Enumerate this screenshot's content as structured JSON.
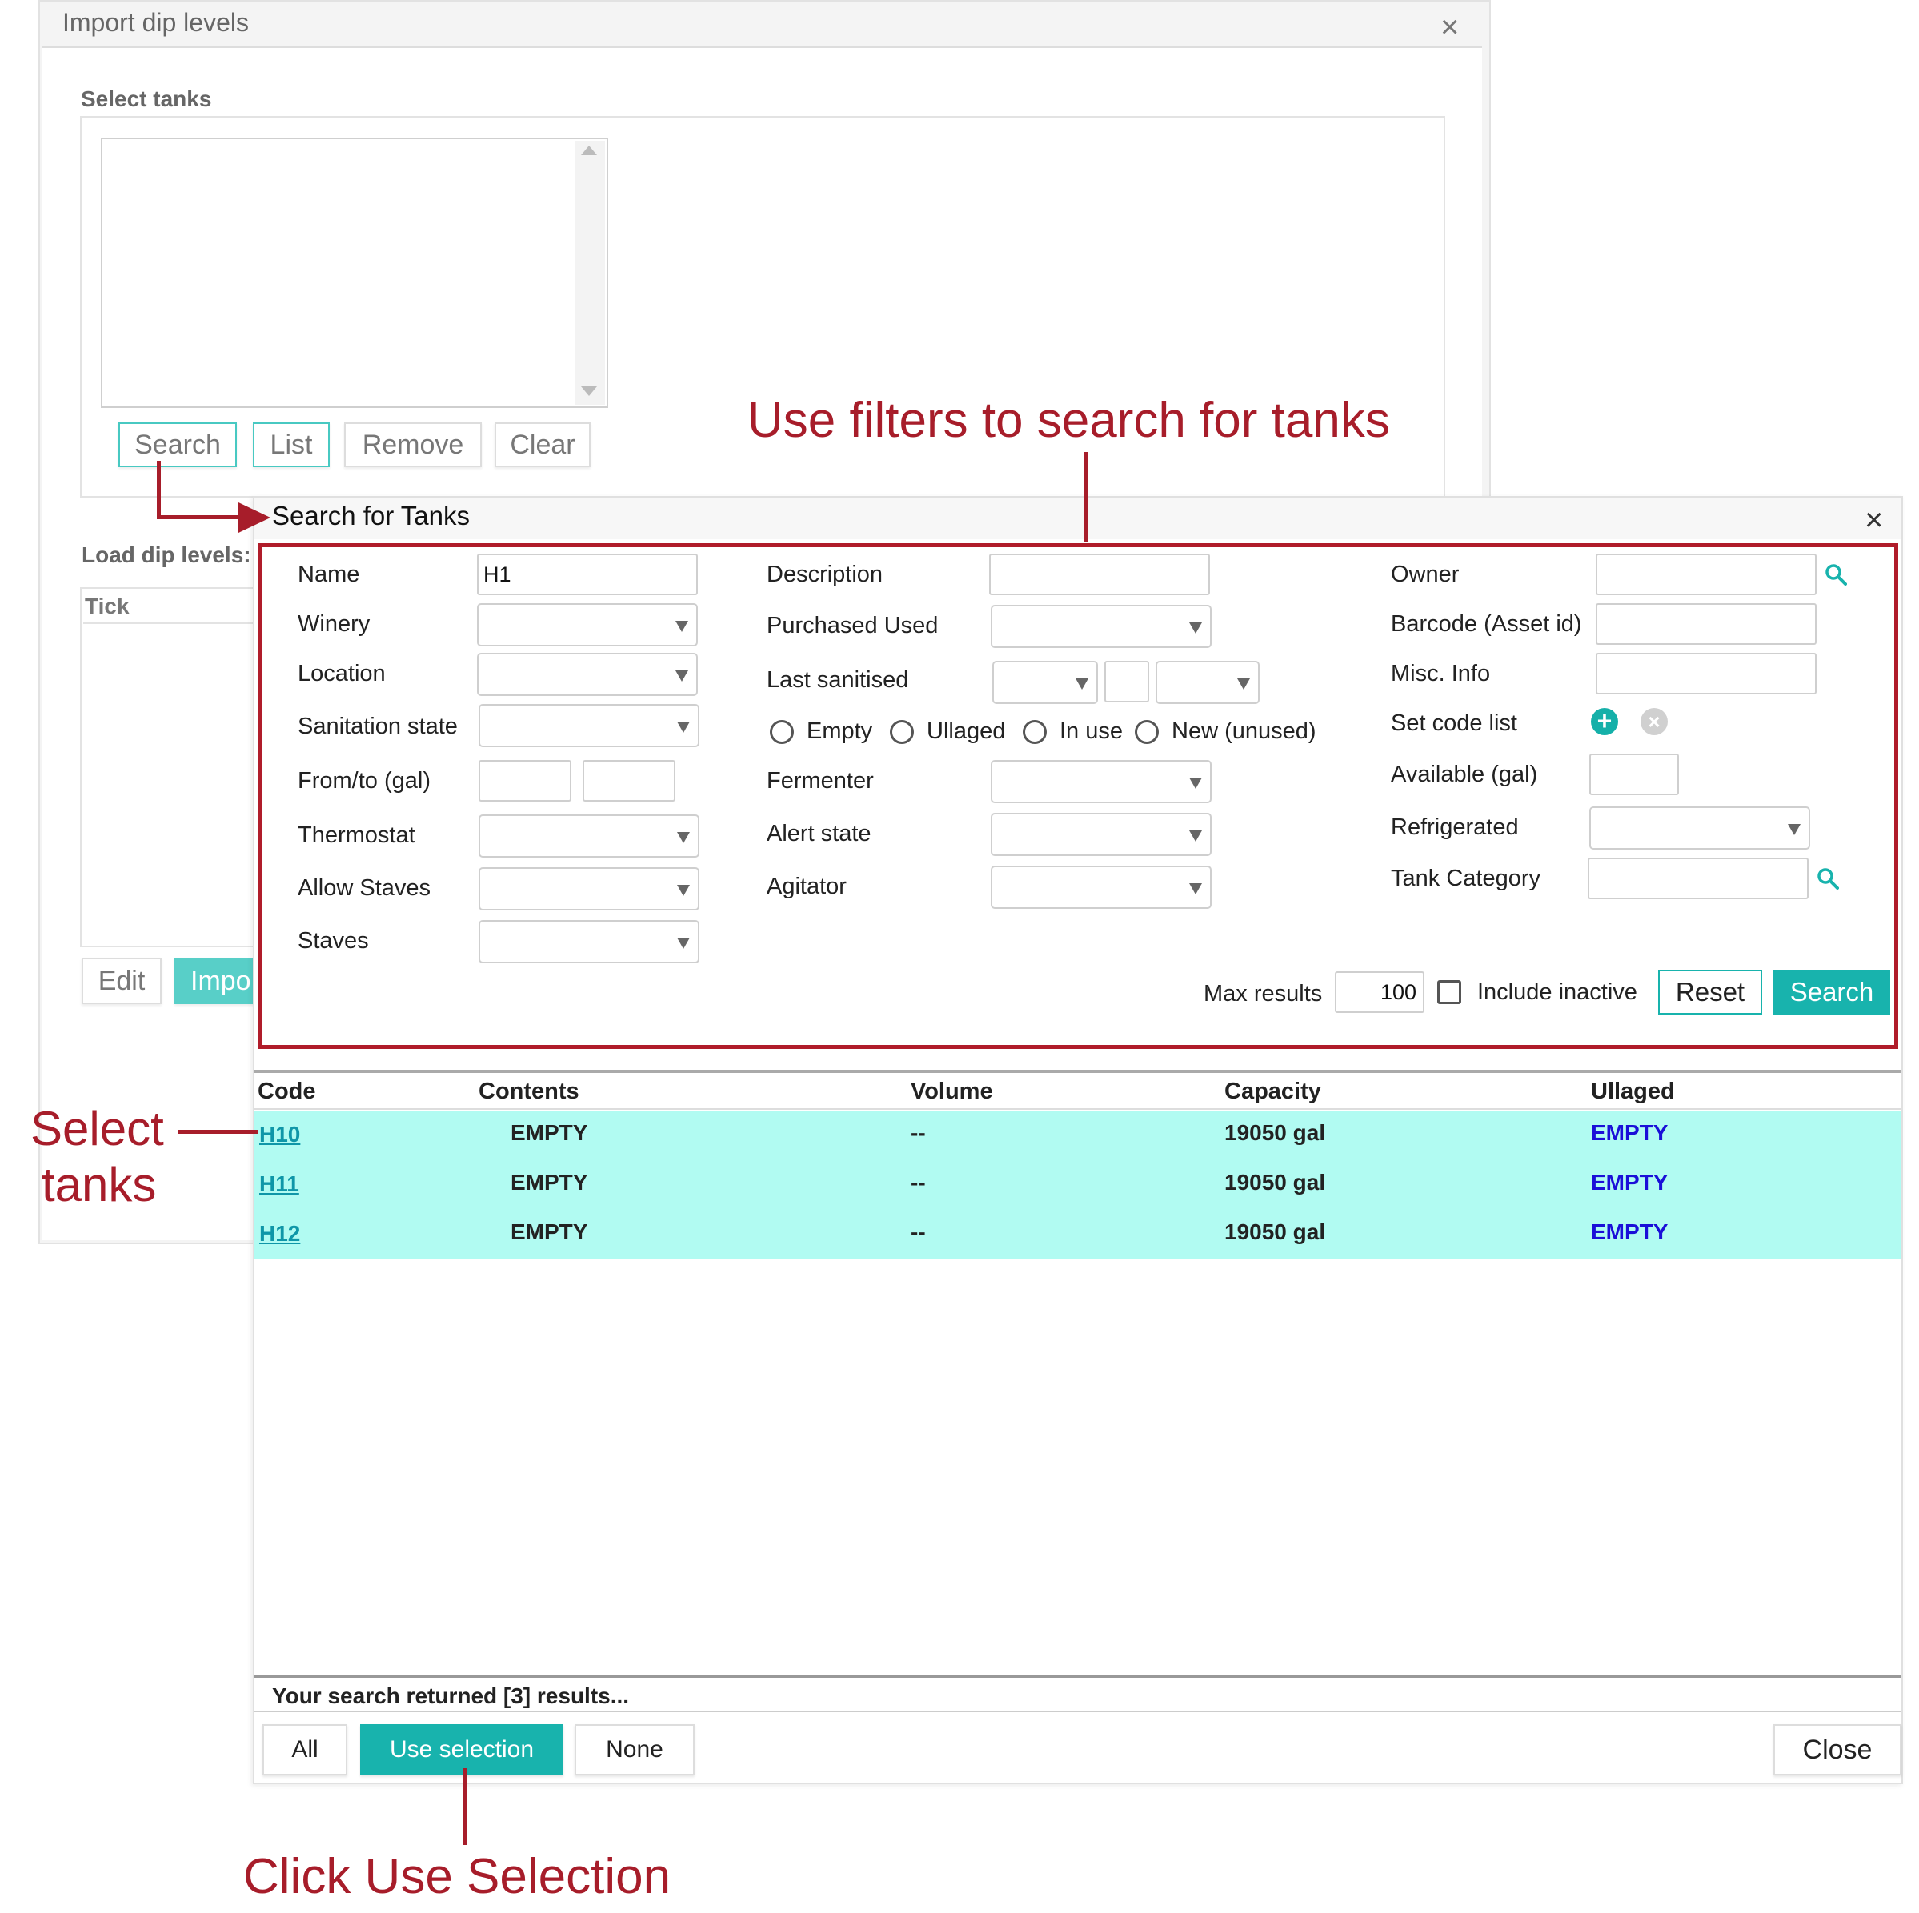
{
  "background_dialog": {
    "title": "Import dip levels",
    "close_glyph": "×",
    "select_tanks_label": "Select tanks",
    "buttons": {
      "search": "Search",
      "list": "List",
      "remove": "Remove",
      "clear": "Clear"
    },
    "load_dip_label": "Load dip levels:",
    "tick_header": "Tick",
    "edit_button": "Edit",
    "import_button": "Impo"
  },
  "search_dialog": {
    "title": "Search for Tanks",
    "close_glyph": "×",
    "filters": {
      "name_label": "Name",
      "name_value": "H1",
      "winery_label": "Winery",
      "location_label": "Location",
      "sanitation_state_label": "Sanitation state",
      "from_to_label": "From/to (gal)",
      "thermostat_label": "Thermostat",
      "allow_staves_label": "Allow Staves",
      "staves_label": "Staves",
      "description_label": "Description",
      "purchased_used_label": "Purchased Used",
      "last_sanitised_label": "Last sanitised",
      "radio_empty": "Empty",
      "radio_ullaged": "Ullaged",
      "radio_in_use": "In use",
      "radio_new": "New (unused)",
      "fermenter_label": "Fermenter",
      "alert_state_label": "Alert state",
      "agitator_label": "Agitator",
      "owner_label": "Owner",
      "barcode_label": "Barcode (Asset id)",
      "misc_info_label": "Misc. Info",
      "set_code_list_label": "Set code list",
      "available_label": "Available (gal)",
      "refrigerated_label": "Refrigerated",
      "tank_category_label": "Tank Category",
      "max_results_label": "Max results",
      "max_results_value": "100",
      "include_inactive_label": "Include inactive",
      "reset_button": "Reset",
      "search_button": "Search"
    },
    "table": {
      "columns": [
        "Code",
        "Contents",
        "Volume",
        "Capacity",
        "Ullaged"
      ],
      "rows": [
        {
          "code": "H10",
          "contents": "EMPTY",
          "volume": "--",
          "capacity": "19050 gal",
          "ullaged": "EMPTY"
        },
        {
          "code": "H11",
          "contents": "EMPTY",
          "volume": "--",
          "capacity": "19050 gal",
          "ullaged": "EMPTY"
        },
        {
          "code": "H12",
          "contents": "EMPTY",
          "volume": "--",
          "capacity": "19050 gal",
          "ullaged": "EMPTY"
        }
      ],
      "row_highlight_color": "#b1fbf2"
    },
    "results_count": "Your search returned [3] results...",
    "footer": {
      "all": "All",
      "use_selection": "Use selection",
      "none": "None",
      "close": "Close"
    }
  },
  "annotations": {
    "filters": "Use filters to search for tanks",
    "select_line1": "Select",
    "select_line2": "tanks",
    "click": "Click Use Selection",
    "color": "#a71d2a"
  },
  "icons": {
    "owner_lookup": "search-icon",
    "category_lookup": "search-icon",
    "add_code": "plus-circle-icon",
    "clear_code": "x-circle-icon"
  }
}
